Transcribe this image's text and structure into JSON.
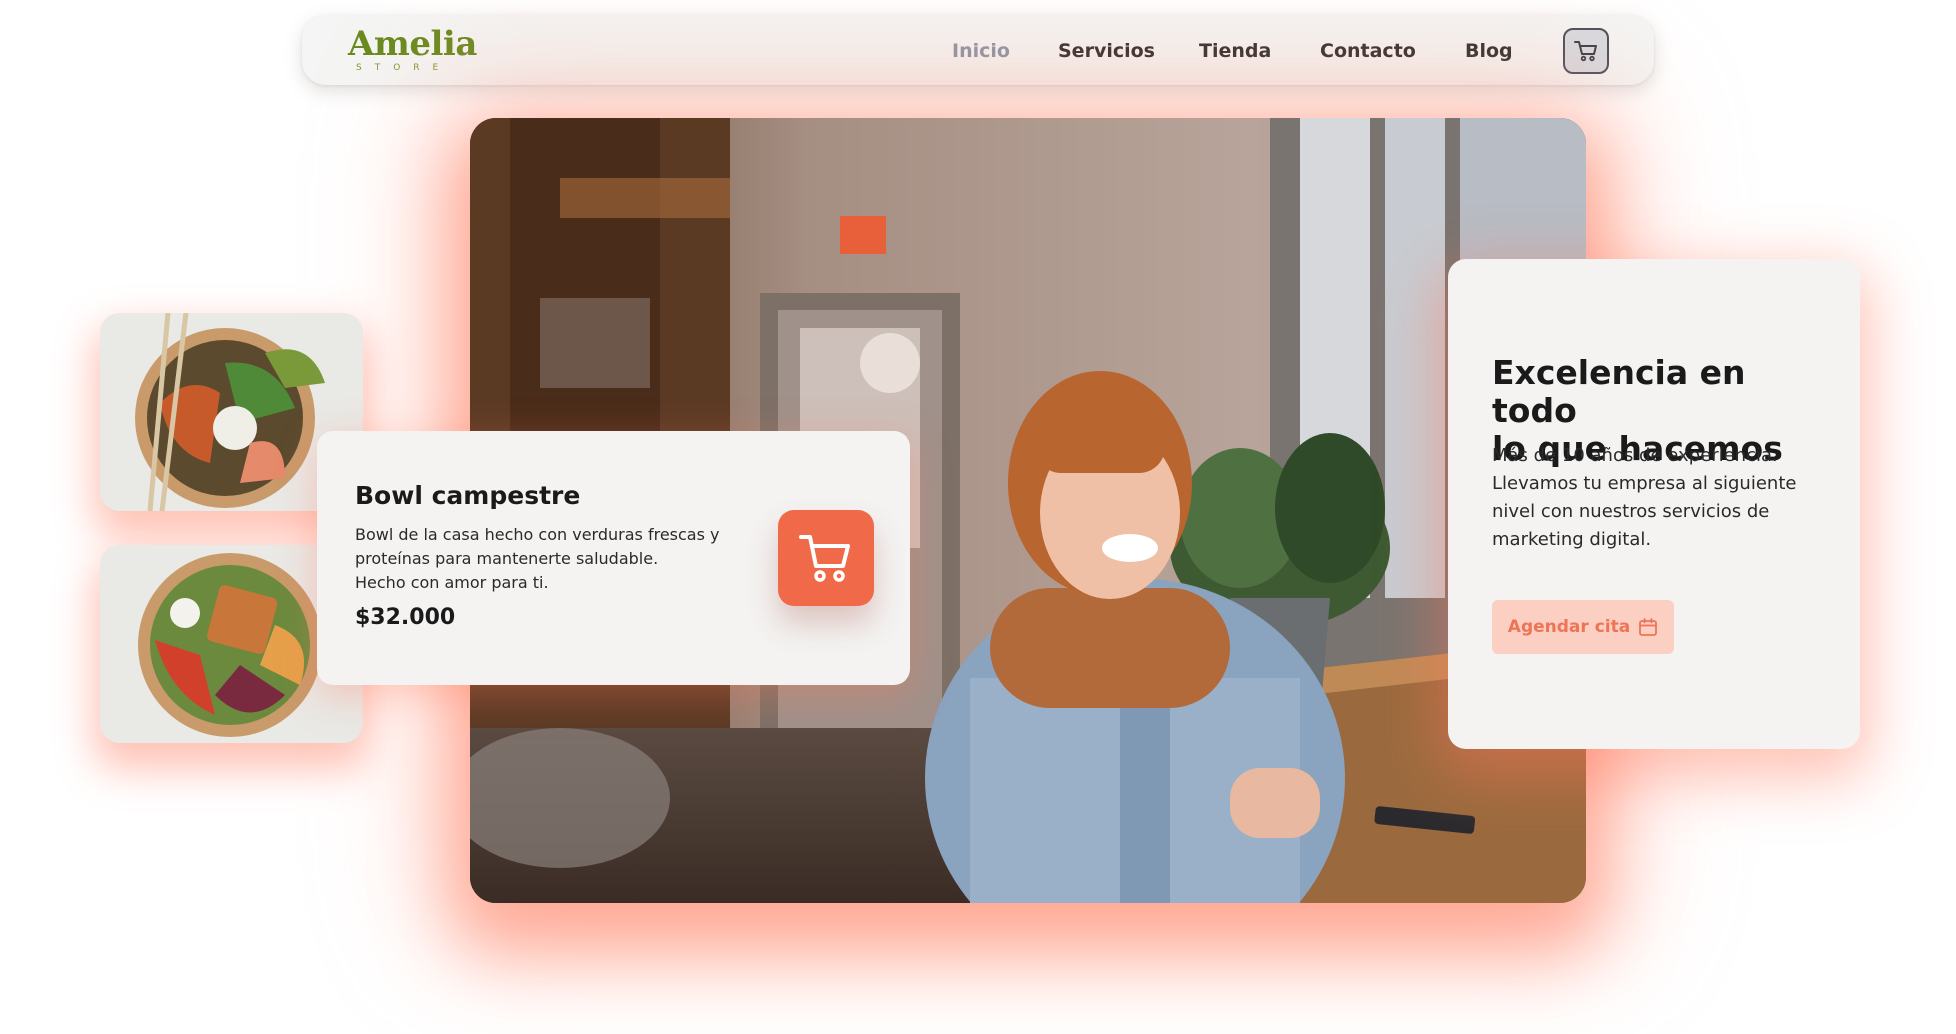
{
  "brand": {
    "name": "Amelia",
    "tagline": "STORE"
  },
  "nav": {
    "links": [
      {
        "label": "Inicio",
        "active": true
      },
      {
        "label": "Servicios",
        "active": false
      },
      {
        "label": "Tienda",
        "active": false
      },
      {
        "label": "Contacto",
        "active": false
      },
      {
        "label": "Blog",
        "active": false
      }
    ],
    "cart_icon": "shopping-cart-icon"
  },
  "product": {
    "title": "Bowl campestre",
    "description_lines": [
      "Bowl de la casa hecho con verduras frescas y",
      "proteínas para mantenerte saludable.",
      "Hecho con amor para ti."
    ],
    "price": "$32.000",
    "cart_icon": "shopping-cart-icon"
  },
  "info": {
    "title_lines": [
      "Excelencia en todo",
      "lo que hacemos"
    ],
    "text_lines": [
      "Más de 10 años de experiencia.",
      "Llevamos tu empresa al siguiente",
      "nivel con nuestros servicios de",
      "marketing digital."
    ],
    "cta_label": "Agendar cita",
    "cta_icon": "calendar-icon"
  },
  "colors": {
    "accent": "#f06a4a",
    "accent_soft": "#fbcfc2",
    "brand_green": "#6a8a1e",
    "glow": "#ff785a"
  }
}
